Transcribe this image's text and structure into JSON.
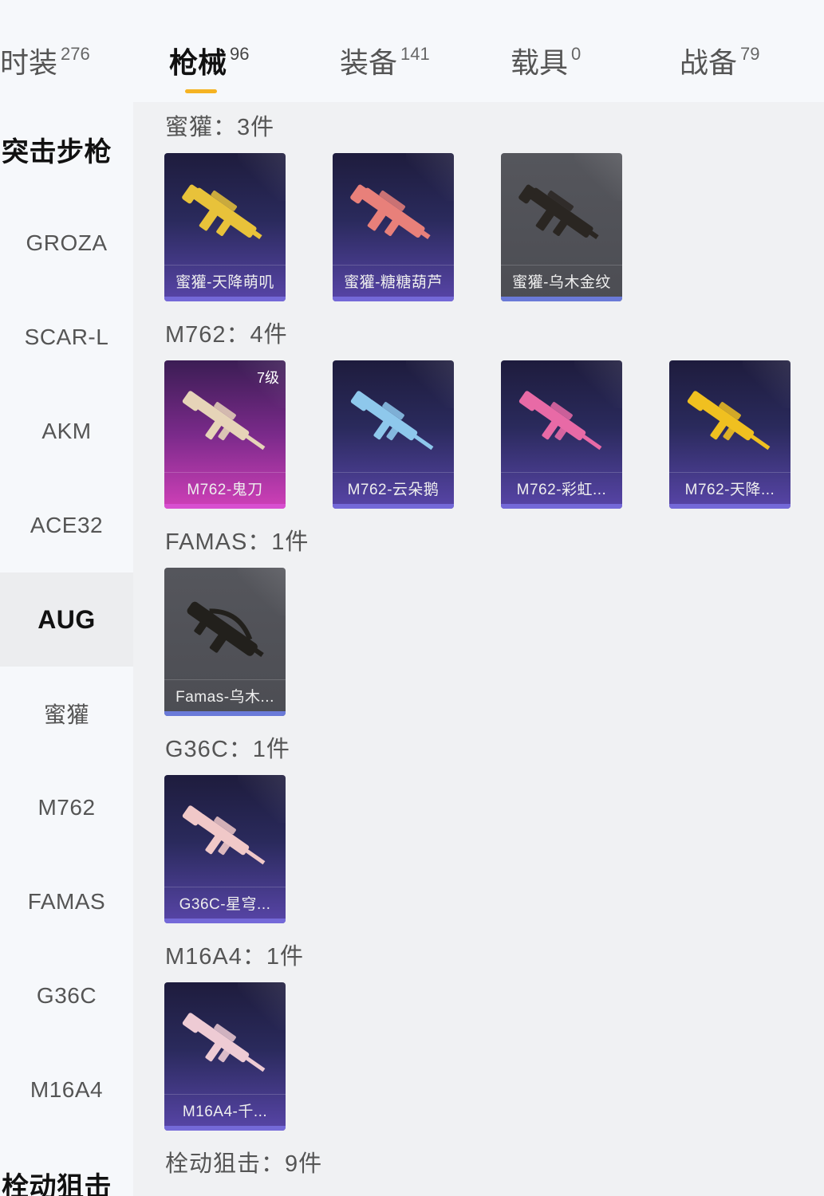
{
  "tabs": [
    {
      "label": "时装",
      "count": "276"
    },
    {
      "label": "枪械",
      "count": "96"
    },
    {
      "label": "装备",
      "count": "141"
    },
    {
      "label": "载具",
      "count": "0"
    },
    {
      "label": "战备",
      "count": "79"
    }
  ],
  "sidebar": {
    "group_top": "突击步枪",
    "items": [
      "GROZA",
      "SCAR-L",
      "AKM",
      "ACE32",
      "AUG",
      "蜜獾",
      "M762",
      "FAMAS",
      "G36C",
      "M16A4"
    ],
    "active_item": "AUG",
    "group_bottom": "栓动狙击"
  },
  "sections": [
    {
      "title": "蜜獾：3件",
      "cards": [
        {
          "label": "蜜獾-天降萌叽",
          "style": "purple",
          "gun_color": "#e8c23a"
        },
        {
          "label": "蜜獾-糖糖葫芦",
          "style": "purple",
          "gun_color": "#e8807a"
        },
        {
          "label": "蜜獾-乌木金纹",
          "style": "gray",
          "gun_color": "#2a2622"
        }
      ]
    },
    {
      "title": "M762：4件",
      "cards": [
        {
          "label": "M762-鬼刀",
          "style": "pink",
          "gun_color": "#e6d4b8",
          "level": "7级"
        },
        {
          "label": "M762-云朵鹅",
          "style": "purple",
          "gun_color": "#8ec8ec"
        },
        {
          "label": "M762-彩虹...",
          "style": "purple",
          "gun_color": "#e86aa6"
        },
        {
          "label": "M762-天降...",
          "style": "purple",
          "gun_color": "#f0c020"
        }
      ]
    },
    {
      "title": "FAMAS：1件",
      "cards": [
        {
          "label": "Famas-乌木...",
          "style": "gray",
          "gun_color": "#22201c"
        }
      ]
    },
    {
      "title": "G36C：1件",
      "cards": [
        {
          "label": "G36C-星穹...",
          "style": "purple",
          "gun_color": "#f0c8c8"
        }
      ]
    },
    {
      "title": "M16A4：1件",
      "cards": [
        {
          "label": "M16A4-千...",
          "style": "purple",
          "gun_color": "#eecbd4"
        }
      ]
    },
    {
      "title": "栓动狙击：9件",
      "cards": []
    }
  ]
}
